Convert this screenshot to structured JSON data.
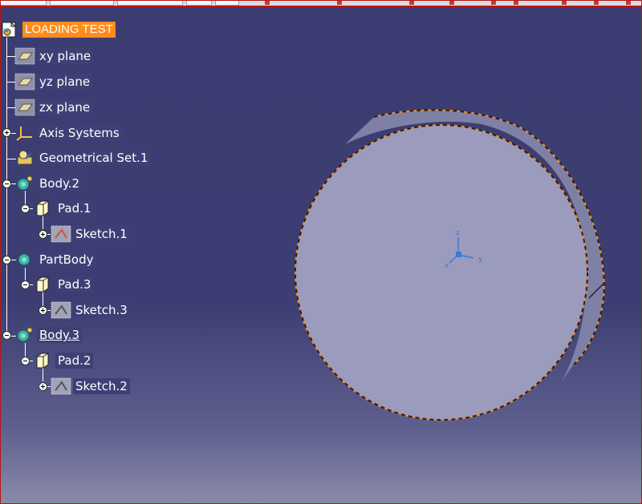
{
  "tree": {
    "root_label": "LOADING TEST",
    "items": [
      {
        "label": "xy plane",
        "icon": "plane-icon"
      },
      {
        "label": "yz plane",
        "icon": "plane-icon"
      },
      {
        "label": "zx plane",
        "icon": "plane-icon"
      },
      {
        "label": "Axis Systems",
        "icon": "axis-systems-icon"
      },
      {
        "label": "Geometrical Set.1",
        "icon": "geometrical-set-icon"
      },
      {
        "label": "Body.2",
        "icon": "body-icon"
      },
      {
        "label": "Pad.1",
        "icon": "pad-icon"
      },
      {
        "label": "Sketch.1",
        "icon": "sketch-icon"
      },
      {
        "label": "PartBody",
        "icon": "part-body-icon"
      },
      {
        "label": "Pad.3",
        "icon": "pad-icon"
      },
      {
        "label": "Sketch.3",
        "icon": "sketch-icon"
      },
      {
        "label": "Body.3",
        "icon": "body-icon"
      },
      {
        "label": "Pad.2",
        "icon": "pad-icon"
      },
      {
        "label": "Sketch.2",
        "icon": "sketch-icon"
      }
    ]
  },
  "compass": {
    "x_label": "x",
    "y_label": "y",
    "z_label": "z"
  },
  "colors": {
    "background": "#3c3e73",
    "root_highlight": "#ff8c1a",
    "cylinder_face": "#9899bb",
    "cylinder_side": "#7c7ea3",
    "selection_edge": "#f08a2a"
  }
}
